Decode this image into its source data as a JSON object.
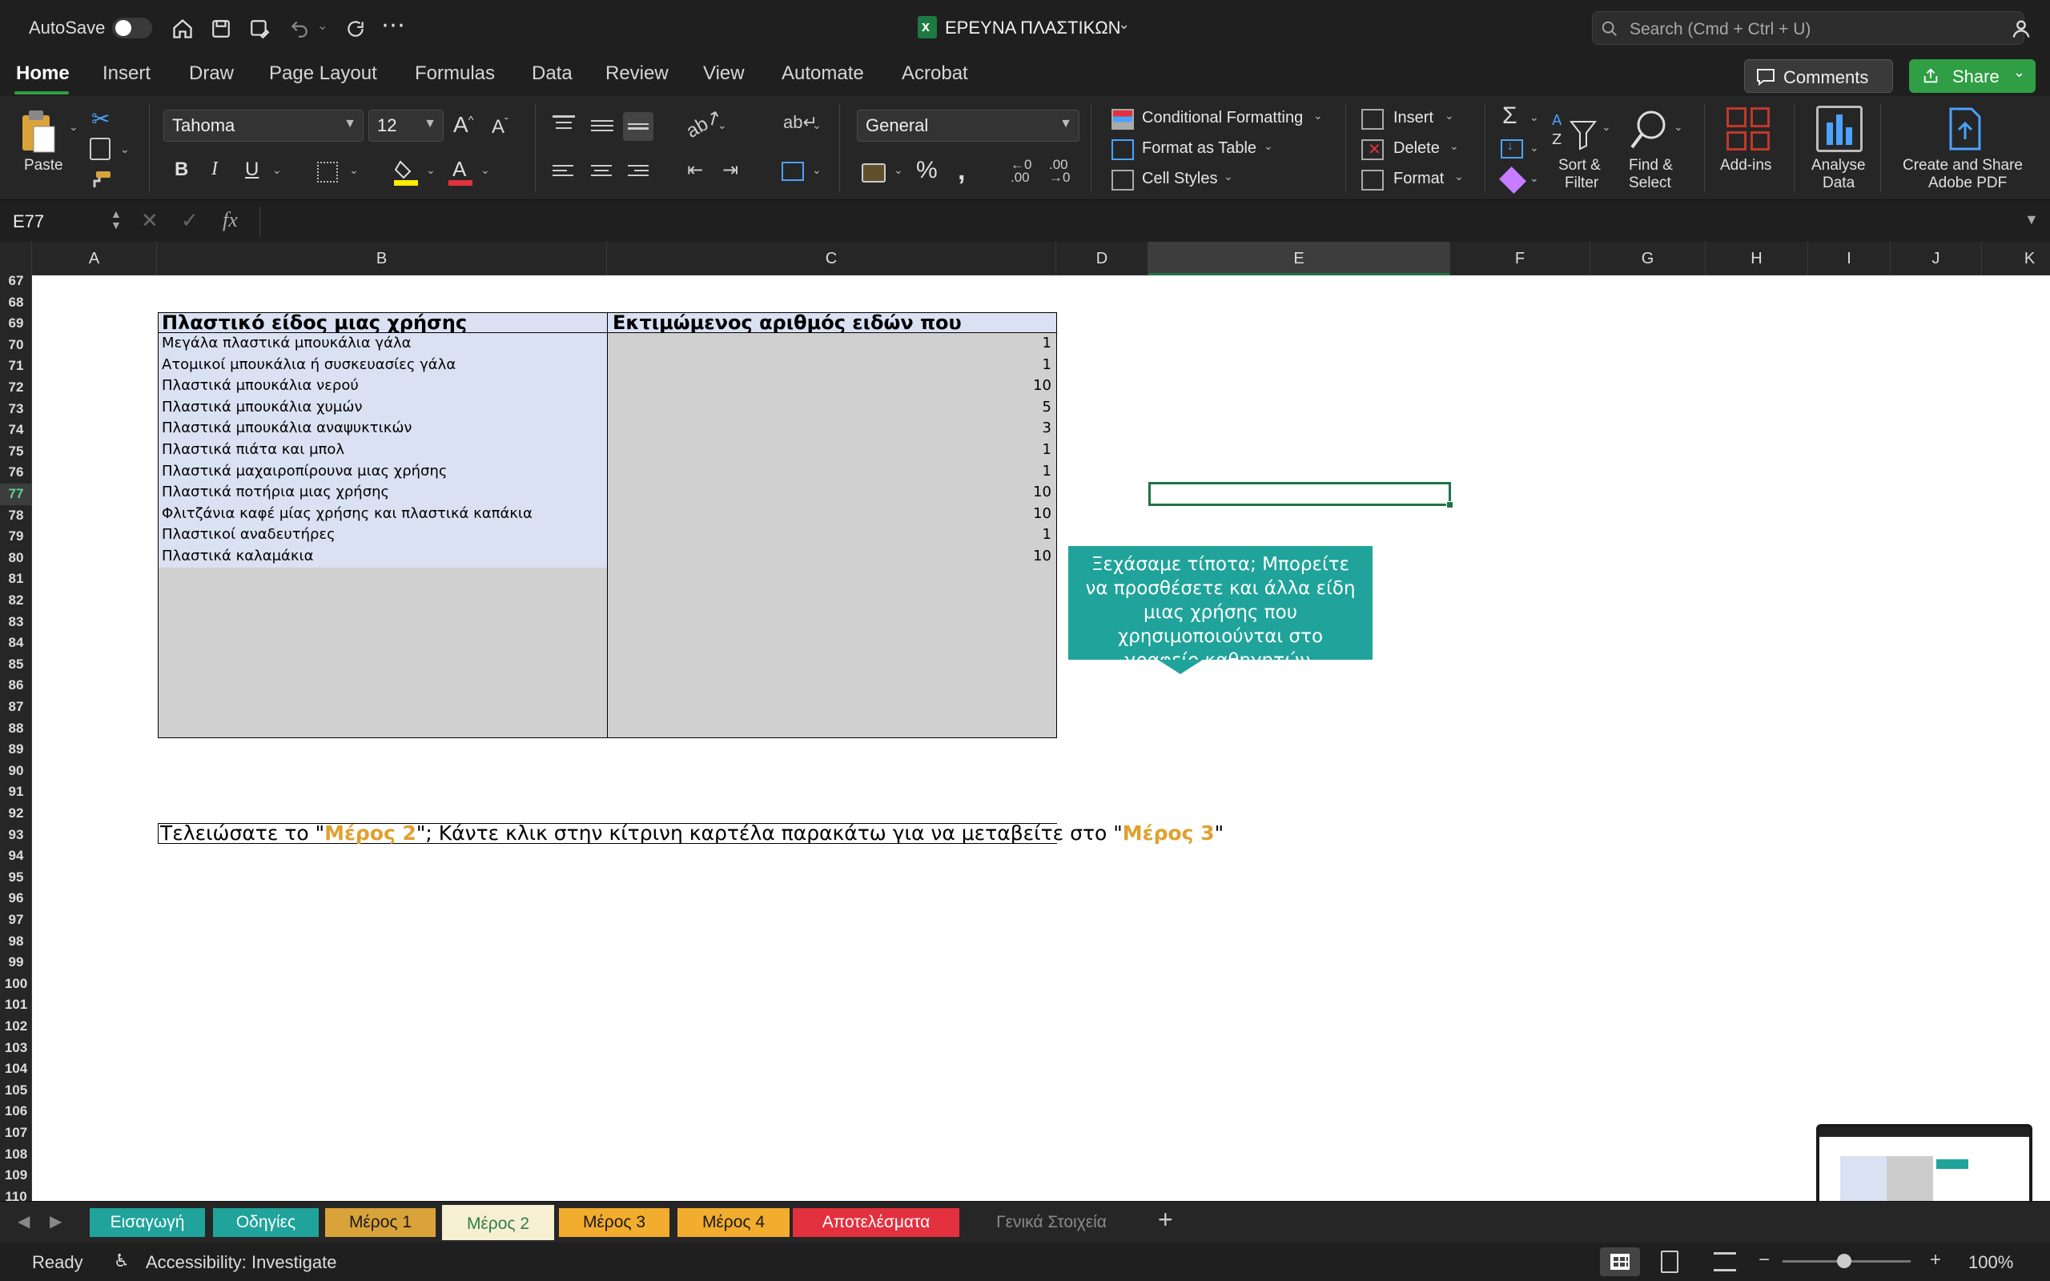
{
  "titlebar": {
    "autosave_label": "AutoSave",
    "doc_title": "ΕΡΕΥΝΑ ΠΛΑΣΤΙΚΩΝ",
    "search_placeholder": "Search (Cmd + Ctrl + U)"
  },
  "ribbon_tabs": [
    "Home",
    "Insert",
    "Draw",
    "Page Layout",
    "Formulas",
    "Data",
    "Review",
    "View",
    "Automate",
    "Acrobat"
  ],
  "comments_label": "Comments",
  "share_label": "Share",
  "ribbon": {
    "paste": "Paste",
    "font_name": "Tahoma",
    "font_size": "12",
    "number_format": "General",
    "conditional_formatting": "Conditional Formatting",
    "format_as_table": "Format as Table",
    "cell_styles": "Cell Styles",
    "insert": "Insert",
    "delete": "Delete",
    "format": "Format",
    "sort_filter_1": "Sort &",
    "sort_filter_2": "Filter",
    "find_select_1": "Find &",
    "find_select_2": "Select",
    "addins": "Add-ins",
    "analyse_1": "Analyse",
    "analyse_2": "Data",
    "create_pdf_1": "Create and Share",
    "create_pdf_2": "Adobe PDF"
  },
  "formula_bar": {
    "name_box": "E77",
    "fx": "fx",
    "formula": ""
  },
  "columns": [
    {
      "label": "A"
    },
    {
      "label": "B"
    },
    {
      "label": "C"
    },
    {
      "label": "D"
    },
    {
      "label": "E"
    },
    {
      "label": "F"
    },
    {
      "label": "G"
    },
    {
      "label": "H"
    },
    {
      "label": "I"
    },
    {
      "label": "J"
    },
    {
      "label": "K"
    }
  ],
  "rows_start": 67,
  "rows_end": 110,
  "table": {
    "header_item": "Πλαστικό είδος μιας χρήσης",
    "header_count": "Εκτιμώμενος αριθμός ειδών που",
    "rows": [
      {
        "item": "Μεγάλα πλαστικά μπουκάλια γάλα",
        "count": "1"
      },
      {
        "item": "Ατομικοί μπουκάλια ή συσκευασίες γάλα",
        "count": "1"
      },
      {
        "item": "Πλαστικά μπουκάλια νερού",
        "count": "10"
      },
      {
        "item": "Πλαστικά μπουκάλια χυμών",
        "count": "5"
      },
      {
        "item": "Πλαστικά μπουκάλια αναψυκτικών",
        "count": "3"
      },
      {
        "item": "Πλαστικά πιάτα και μπολ",
        "count": "1"
      },
      {
        "item": "Πλαστικά μαχαιροπίρουνα μιας χρήσης",
        "count": "1"
      },
      {
        "item": "Πλαστικά ποτήρια μιας χρήσης",
        "count": "10"
      },
      {
        "item": "Φλιτζάνια καφέ μίας χρήσης και πλαστικά καπάκια",
        "count": "10"
      },
      {
        "item": "Πλαστικοί αναδευτήρες",
        "count": "1"
      },
      {
        "item": "Πλαστικά καλαμάκια",
        "count": "10"
      },
      {
        "item": "",
        "count": ""
      },
      {
        "item": "",
        "count": ""
      },
      {
        "item": "",
        "count": ""
      },
      {
        "item": "",
        "count": ""
      },
      {
        "item": "",
        "count": ""
      },
      {
        "item": "",
        "count": ""
      },
      {
        "item": "",
        "count": ""
      },
      {
        "item": "",
        "count": ""
      }
    ]
  },
  "callout": "Ξεχάσαμε τίποτα; Μπορείτε να προσθέσετε και άλλα είδη μιας χρήσης που χρησιμοποιούνται στο γραφείο καθηγητών.",
  "footer_note": {
    "part1": "Τελειώσατε το \"",
    "part2": "Μέρος 2",
    "part3": "\"; Κάντε κλικ στην κίτρινη καρτέλα παρακάτω για να μεταβείτε στο \"",
    "part4": "Μέρος 3",
    "part5": "\""
  },
  "sheet_tabs": [
    {
      "label": "Εισαγωγή",
      "bg": "#1fa39a",
      "fg": "#ffffff"
    },
    {
      "label": "Οδηγίες",
      "bg": "#1fa39a",
      "fg": "#ffffff"
    },
    {
      "label": "Μέρος 1",
      "bg": "#d9a33a",
      "fg": "#1a1a1a"
    },
    {
      "label": "Μέρος 2",
      "bg": "#f7efd2",
      "fg": "#2f7d4b"
    },
    {
      "label": "Μέρος 3",
      "bg": "#f2ac2e",
      "fg": "#1a1a1a"
    },
    {
      "label": "Μέρος 4",
      "bg": "#f2ac2e",
      "fg": "#1a1a1a"
    },
    {
      "label": "Αποτελέσματα",
      "bg": "#e3303e",
      "fg": "#ffffff"
    },
    {
      "label": "Γενικά Στοιχεία",
      "bg": "#262626",
      "fg": "#8a8a8a"
    }
  ],
  "status": {
    "ready": "Ready",
    "accessibility": "Accessibility: Investigate",
    "zoom": "100%"
  },
  "colors": {
    "accent_green": "#2f9e44",
    "table_label_bg": "#d9e1f2",
    "table_value_bg": "#d0d0d0",
    "callout_bg": "#1fa39a",
    "highlight_orange": "#e0a030"
  }
}
